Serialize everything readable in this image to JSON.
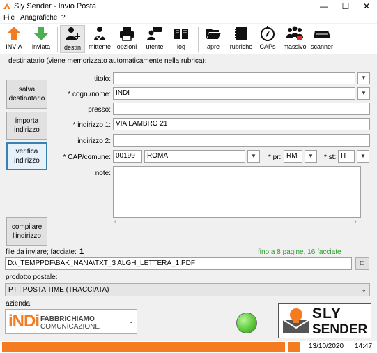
{
  "window": {
    "title": "Sly Sender - Invio Posta",
    "minimize": "—",
    "maximize": "☐",
    "close": "✕"
  },
  "menu": {
    "file": "File",
    "anagrafiche": "Anagrafiche",
    "help": "?"
  },
  "toolbar": {
    "invia": "INVIA",
    "inviata": "inviata",
    "destin": "destin",
    "mittente": "mittente",
    "opzioni": "opzioni",
    "utente": "utente",
    "log": "log",
    "apre": "apre",
    "rubriche": "rubriche",
    "caps": "CAPs",
    "massivo": "massivo",
    "scanner": "scanner"
  },
  "form": {
    "heading": "destinatario (viene memorizzato automaticamente nella rubrica):",
    "titolo_label": "titolo:",
    "titolo_value": "",
    "cognome_label": "* cogn./nome:",
    "cognome_value": "INDI",
    "presso_label": "presso:",
    "presso_value": "",
    "indirizzo1_label": "* indirizzo 1:",
    "indirizzo1_value": "VIA LAMBRO 21",
    "indirizzo2_label": "indirizzo 2:",
    "indirizzo2_value": "",
    "cap_label": "* CAP/comune:",
    "cap_value": "00199",
    "comune_value": "ROMA",
    "pr_label": "* pr:",
    "pr_value": "RM",
    "st_label": "* st:",
    "st_value": "IT",
    "note_label": "note:",
    "note_value": ""
  },
  "side_buttons": {
    "salva": "salva destinatario",
    "importa": "importa indirizzo",
    "verifica": "verifica indirizzo",
    "compilare": "compilare l'indirizzo"
  },
  "file_section": {
    "label": "file da inviare; facciate:",
    "facciate": "1",
    "info": "fino a 8 pagine, 16 facciate",
    "path": "D:\\_TEMPPDF\\BAK_NANA\\TXT_3 ALGH_LETTERA_1.PDF",
    "browse": "□"
  },
  "product": {
    "label": "prodotto postale:",
    "value": "PT ¦ POSTA TIME (TRACCIATA)"
  },
  "azienda": {
    "label": "azienda:",
    "logo_mark": "iNDi",
    "logo_line1": "FABBRICHIAMO",
    "logo_line2": "COMUNICAZIONE"
  },
  "brand": {
    "line1": "SLY",
    "line2": "SENDER"
  },
  "status": {
    "date": "13/10/2020",
    "time": "14:47"
  },
  "colors": {
    "accent": "#f47b20",
    "green_text": "#2a9d2a",
    "status_green": "#5cc93a",
    "focus_blue": "#3c7fb1"
  }
}
